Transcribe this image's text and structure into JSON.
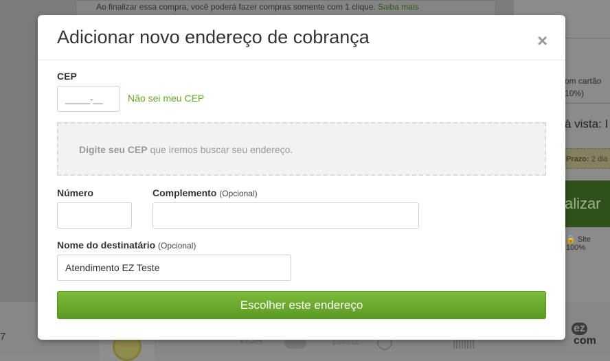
{
  "background": {
    "top_notice": "Ao finalizar essa compra, você poderá fazer compras somente com 1 clique.",
    "top_notice_link": "Saiba mais",
    "right_cartao_line1": "om cartão",
    "right_cartao_line2": "10%)",
    "right_vista": "à vista: I",
    "right_prazo_label": "Prazo:",
    "right_prazo_value": "2 dia",
    "right_finalizar": "alizar",
    "right_site": "Site 100%",
    "footer_digit": "7",
    "footer_visa": "VISA",
    "footer_amex": "EXPRESS",
    "footer_ez": "ez",
    "footer_com": "com"
  },
  "modal": {
    "title": "Adicionar novo endereço de cobrança",
    "close_symbol": "×",
    "cep": {
      "label": "CEP",
      "placeholder": "_____-__",
      "link": "Não sei meu CEP"
    },
    "hint": {
      "bold": "Digite seu CEP",
      "rest": " que iremos buscar seu endereço."
    },
    "numero": {
      "label": "Número",
      "value": ""
    },
    "complemento": {
      "label": "Complemento",
      "optional": "(Opcional)",
      "value": ""
    },
    "destinatario": {
      "label": "Nome do destinatário",
      "optional": "(Opcional)",
      "value": "Atendimento EZ Teste"
    },
    "submit": "Escolher este endereço"
  },
  "colors": {
    "accent_green": "#67a724",
    "button_green": "#6aa92e",
    "overlay": "#8a8a8a"
  }
}
